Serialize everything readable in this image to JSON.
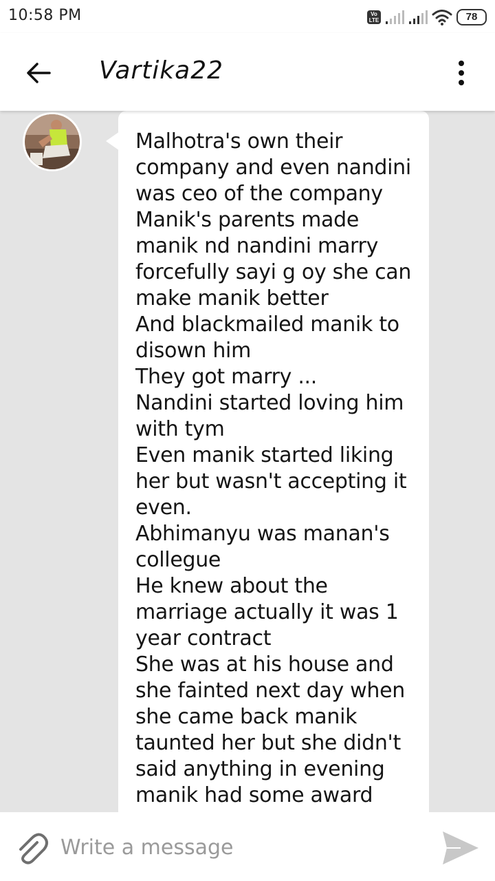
{
  "status_bar": {
    "time": "10:58 PM",
    "volte_label": "Vo LTE",
    "battery": "78"
  },
  "header": {
    "title": "Vartika22",
    "back_icon": "arrow-left-icon",
    "menu_icon": "more-vert-icon"
  },
  "message": {
    "lines": [
      "Malhotra's own their",
      "company and even nandini",
      "was ceo of the company",
      "Manik's parents made",
      "manik nd nandini marry",
      "forcefully sayi g oy she can",
      "make manik better",
      "And blackmailed manik to",
      "disown him",
      "They got marry ...",
      "Nandini started loving him",
      "with tym",
      "Even manik started liking",
      "her but wasn't accepting it",
      "even.",
      "Abhimanyu was manan's",
      "collegue",
      "He knew about the",
      "marriage actually it was 1",
      "year contract",
      "She was at his house and",
      "she fainted next day when",
      "she came back manik",
      "taunted her but she didn't",
      "said anything in evening",
      "manik had some award"
    ]
  },
  "composer": {
    "placeholder": "Write a message",
    "attach_icon": "paperclip-icon",
    "send_icon": "send-icon"
  },
  "colors": {
    "background": "#e4e4e4",
    "bubble": "#ffffff",
    "text": "#151515",
    "placeholder": "#9a9a9a",
    "send_icon": "#c8c8c8"
  }
}
